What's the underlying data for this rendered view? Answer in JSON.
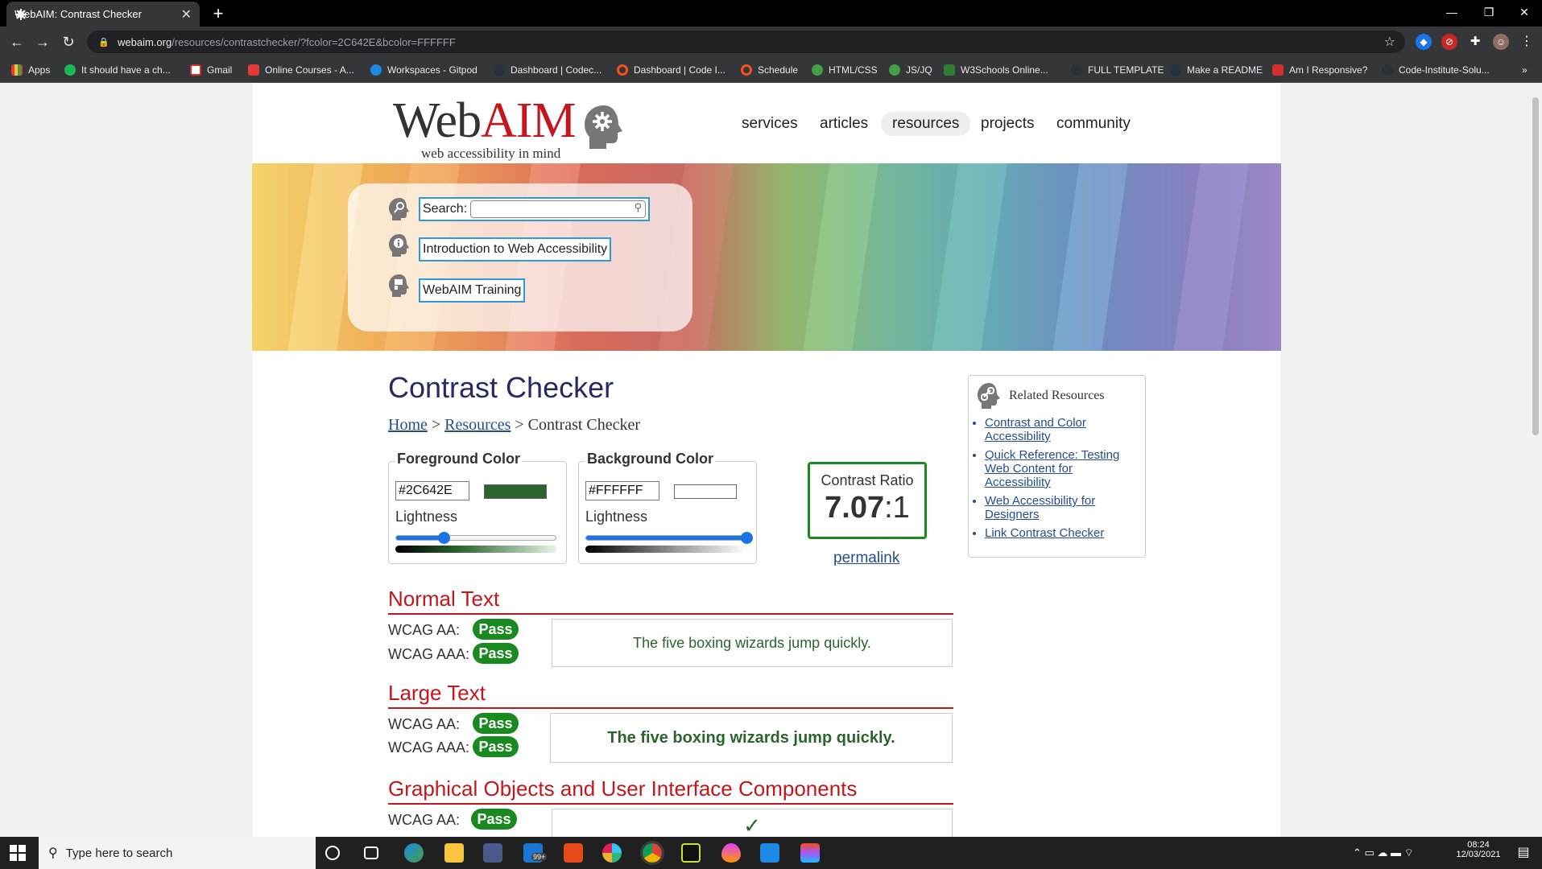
{
  "browser": {
    "tab_title": "WebAIM: Contrast Checker",
    "url_host": "webaim.org",
    "url_path": "/resources/contrastchecker/?fcolor=2C642E&bcolor=FFFFFF",
    "bookmarks": [
      "Apps",
      "It should have a ch...",
      "Gmail",
      "Online Courses - A...",
      "Workspaces - Gitpod",
      "Dashboard | Codec...",
      "Dashboard | Code I...",
      "Schedule",
      "HTML/CSS",
      "JS/JQ",
      "W3Schools Online...",
      "FULL TEMPLATE",
      "Make a README",
      "Am I Responsive?",
      "Code-Institute-Solu..."
    ]
  },
  "site": {
    "logo_web": "Web",
    "logo_aim": "AIM",
    "logo_tagline": "web accessibility in mind",
    "nav": [
      "services",
      "articles",
      "resources",
      "projects",
      "community"
    ],
    "search_label": "Search:",
    "intro_link": "Introduction to Web Accessibility",
    "training_link": "WebAIM Training"
  },
  "checker": {
    "title": "Contrast Checker",
    "breadcrumb_home": "Home",
    "breadcrumb_resources": "Resources",
    "breadcrumb_current": "Contrast Checker",
    "breadcrumb_sep": ">",
    "fg_legend": "Foreground Color",
    "fg_hex": "#2C642E",
    "fg_color": "#2C642E",
    "fg_lightness_fraction": 0.3,
    "bg_legend": "Background Color",
    "bg_hex": "#FFFFFF",
    "bg_color": "#FFFFFF",
    "bg_lightness_fraction": 1.0,
    "lightness_label": "Lightness",
    "ratio_label": "Contrast Ratio",
    "ratio_main": "7.07",
    "ratio_suffix": ":1",
    "permalink": "permalink"
  },
  "results": {
    "normal_heading": "Normal Text",
    "large_heading": "Large Text",
    "graphical_heading": "Graphical Objects and User Interface Components",
    "wcag_aa": "WCAG AA:",
    "wcag_aaa": "WCAG AAA:",
    "pass": "Pass",
    "sample_text": "The five boxing wizards jump quickly.",
    "check_glyph": "✓"
  },
  "related": {
    "heading": "Related Resources",
    "links": [
      "Contrast and Color Accessibility",
      "Quick Reference: Testing Web Content for Accessibility",
      "Web Accessibility for Designers",
      "Link Contrast Checker"
    ]
  },
  "taskbar": {
    "search_placeholder": "Type here to search",
    "mail_badge": "99+",
    "time": "08:24",
    "date": "12/03/2021"
  }
}
